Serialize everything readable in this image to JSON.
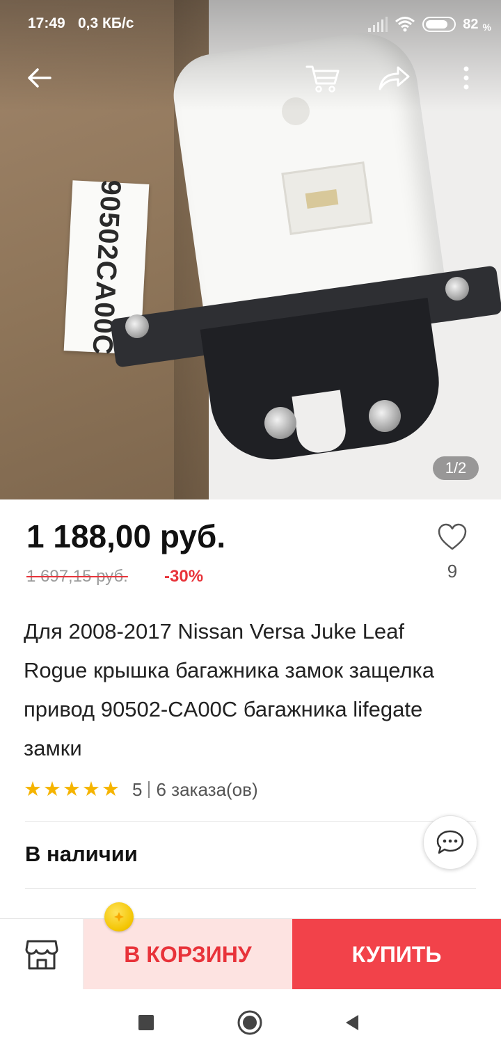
{
  "status_bar": {
    "time": "17:49",
    "speed": "0,3 КБ/с",
    "battery": "82",
    "battery_unit": "%",
    "battery_level": 0.82
  },
  "toolbar": {
    "back_icon": "arrow-left-icon",
    "cart_icon": "cart-icon",
    "share_icon": "share-icon",
    "more_icon": "more-vertical-icon"
  },
  "gallery": {
    "counter": "1/2",
    "label_text": "90502CA00C"
  },
  "product": {
    "price": "1 188,00 руб.",
    "old_price": "1 697,15 руб.",
    "discount": "-30%",
    "wishlist_count": "9",
    "title": "Для 2008-2017 Nissan Versa Juke Leaf Rogue крышка багажника замок защелка привод 90502-CA00C багажника lifegate замки",
    "rating": {
      "stars": 5,
      "value": "5",
      "orders": "6 заказа(ов)"
    },
    "stock": "В наличии"
  },
  "actions": {
    "store_icon": "store-icon",
    "add_to_cart": "В КОРЗИНУ",
    "buy": "КУПИТЬ"
  },
  "colors": {
    "accent": "#e8333a",
    "buy_bg": "#f2424a",
    "cart_bg": "#fde3e1",
    "star": "#f5b400"
  }
}
